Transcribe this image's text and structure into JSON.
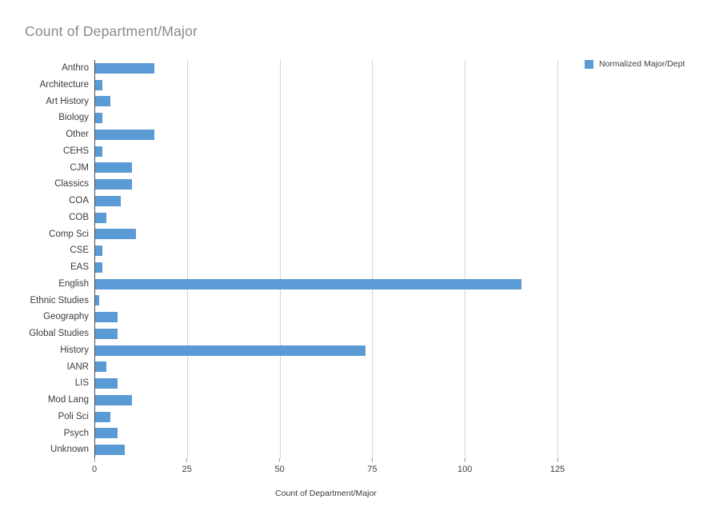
{
  "chart_data": {
    "type": "bar",
    "orientation": "horizontal",
    "title": "Count of Department/Major",
    "xlabel": "Count of Department/Major",
    "ylabel": "",
    "xlim": [
      0,
      125
    ],
    "xticks": [
      0,
      25,
      50,
      75,
      100,
      125
    ],
    "grid": true,
    "grid_axis": "x",
    "legend": {
      "position": "top-right",
      "entries": [
        {
          "label": "Normalized Major/Dept",
          "color": "#5b9bd5"
        }
      ]
    },
    "series": [
      {
        "name": "Normalized Major/Dept",
        "color": "#5b9bd5",
        "values": [
          16,
          2,
          4,
          2,
          16,
          2,
          10,
          10,
          7,
          3,
          11,
          2,
          2,
          115,
          1,
          6,
          6,
          73,
          3,
          6,
          10,
          4,
          6,
          8
        ]
      }
    ],
    "categories": [
      "Anthro",
      "Architecture",
      "Art History",
      "Biology",
      "Other",
      "CEHS",
      "CJM",
      "Classics",
      "COA",
      "COB",
      "Comp Sci",
      "CSE",
      "EAS",
      "English",
      "Ethnic Studies",
      "Geography",
      "Global Studies",
      "History",
      "IANR",
      "LIS",
      "Mod Lang",
      "Poli Sci",
      "Psych",
      "Unknown"
    ],
    "values": [
      16,
      2,
      4,
      2,
      16,
      2,
      10,
      10,
      7,
      3,
      11,
      2,
      2,
      115,
      1,
      6,
      6,
      73,
      3,
      6,
      10,
      4,
      6,
      8
    ]
  },
  "colors": {
    "bar": "#5b9bd5",
    "title": "#8a8a8a",
    "gridline": "#d4d4d4",
    "axis": "#4a4a4a",
    "text": "#3c3c3c",
    "background": "#ffffff"
  }
}
